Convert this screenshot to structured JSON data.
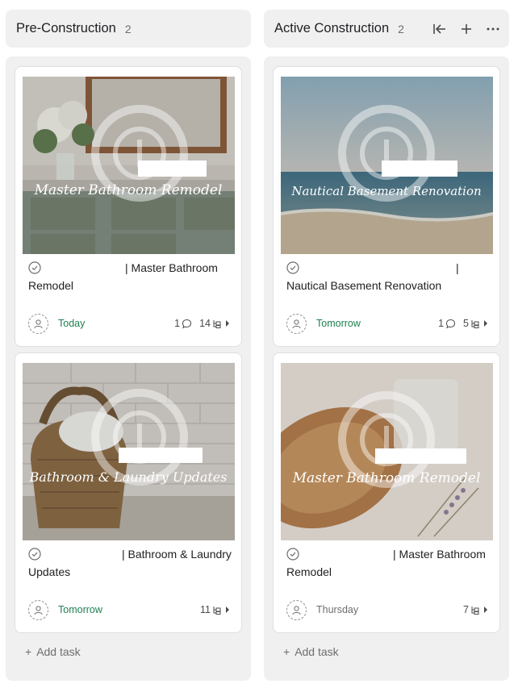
{
  "columns": [
    {
      "title": "Pre-Construction",
      "count": "2",
      "add_task_label": "Add task",
      "cards": [
        {
          "cover_text": "Master Bathroom Remodel",
          "title_text": "| Master Bathroom Remodel",
          "due": "Today",
          "comments": "1",
          "subtasks": "14"
        },
        {
          "cover_text": "Bathroom & Laundry Updates",
          "title_text": "| Bathroom & Laundry Updates",
          "due": "Tomorrow",
          "comments": "",
          "subtasks": "11"
        }
      ]
    },
    {
      "title": "Active Construction",
      "count": "2",
      "add_task_label": "Add task",
      "header_icons": [
        "collapse-column-icon",
        "plus-icon",
        "more-options-icon"
      ],
      "cards": [
        {
          "cover_text": "Nautical Basement Renovation",
          "title_text": "| Nautical Basement Renovation",
          "due": "Tomorrow",
          "comments": "1",
          "subtasks": "5"
        },
        {
          "cover_text": "Master Bathroom Remodel",
          "title_text": "| Master Bathroom Remodel",
          "due": "Thursday",
          "comments": "",
          "subtasks": "7"
        }
      ]
    }
  ],
  "colors": {
    "due_green": "#1e7f50",
    "due_gray": "#6d6e6f",
    "column_bg": "#f0f0f1"
  }
}
